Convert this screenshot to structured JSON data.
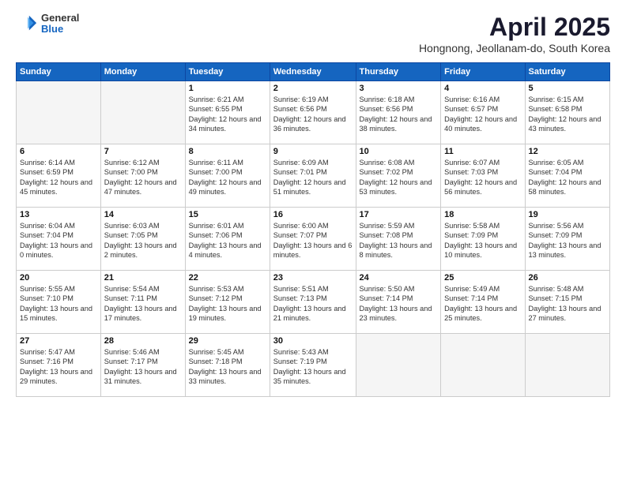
{
  "header": {
    "logo_general": "General",
    "logo_blue": "Blue",
    "main_title": "April 2025",
    "subtitle": "Hongnong, Jeollanam-do, South Korea"
  },
  "days_of_week": [
    "Sunday",
    "Monday",
    "Tuesday",
    "Wednesday",
    "Thursday",
    "Friday",
    "Saturday"
  ],
  "weeks": [
    [
      {
        "day": "",
        "info": ""
      },
      {
        "day": "",
        "info": ""
      },
      {
        "day": "1",
        "info": "Sunrise: 6:21 AM\nSunset: 6:55 PM\nDaylight: 12 hours and 34 minutes."
      },
      {
        "day": "2",
        "info": "Sunrise: 6:19 AM\nSunset: 6:56 PM\nDaylight: 12 hours and 36 minutes."
      },
      {
        "day": "3",
        "info": "Sunrise: 6:18 AM\nSunset: 6:56 PM\nDaylight: 12 hours and 38 minutes."
      },
      {
        "day": "4",
        "info": "Sunrise: 6:16 AM\nSunset: 6:57 PM\nDaylight: 12 hours and 40 minutes."
      },
      {
        "day": "5",
        "info": "Sunrise: 6:15 AM\nSunset: 6:58 PM\nDaylight: 12 hours and 43 minutes."
      }
    ],
    [
      {
        "day": "6",
        "info": "Sunrise: 6:14 AM\nSunset: 6:59 PM\nDaylight: 12 hours and 45 minutes."
      },
      {
        "day": "7",
        "info": "Sunrise: 6:12 AM\nSunset: 7:00 PM\nDaylight: 12 hours and 47 minutes."
      },
      {
        "day": "8",
        "info": "Sunrise: 6:11 AM\nSunset: 7:00 PM\nDaylight: 12 hours and 49 minutes."
      },
      {
        "day": "9",
        "info": "Sunrise: 6:09 AM\nSunset: 7:01 PM\nDaylight: 12 hours and 51 minutes."
      },
      {
        "day": "10",
        "info": "Sunrise: 6:08 AM\nSunset: 7:02 PM\nDaylight: 12 hours and 53 minutes."
      },
      {
        "day": "11",
        "info": "Sunrise: 6:07 AM\nSunset: 7:03 PM\nDaylight: 12 hours and 56 minutes."
      },
      {
        "day": "12",
        "info": "Sunrise: 6:05 AM\nSunset: 7:04 PM\nDaylight: 12 hours and 58 minutes."
      }
    ],
    [
      {
        "day": "13",
        "info": "Sunrise: 6:04 AM\nSunset: 7:04 PM\nDaylight: 13 hours and 0 minutes."
      },
      {
        "day": "14",
        "info": "Sunrise: 6:03 AM\nSunset: 7:05 PM\nDaylight: 13 hours and 2 minutes."
      },
      {
        "day": "15",
        "info": "Sunrise: 6:01 AM\nSunset: 7:06 PM\nDaylight: 13 hours and 4 minutes."
      },
      {
        "day": "16",
        "info": "Sunrise: 6:00 AM\nSunset: 7:07 PM\nDaylight: 13 hours and 6 minutes."
      },
      {
        "day": "17",
        "info": "Sunrise: 5:59 AM\nSunset: 7:08 PM\nDaylight: 13 hours and 8 minutes."
      },
      {
        "day": "18",
        "info": "Sunrise: 5:58 AM\nSunset: 7:09 PM\nDaylight: 13 hours and 10 minutes."
      },
      {
        "day": "19",
        "info": "Sunrise: 5:56 AM\nSunset: 7:09 PM\nDaylight: 13 hours and 13 minutes."
      }
    ],
    [
      {
        "day": "20",
        "info": "Sunrise: 5:55 AM\nSunset: 7:10 PM\nDaylight: 13 hours and 15 minutes."
      },
      {
        "day": "21",
        "info": "Sunrise: 5:54 AM\nSunset: 7:11 PM\nDaylight: 13 hours and 17 minutes."
      },
      {
        "day": "22",
        "info": "Sunrise: 5:53 AM\nSunset: 7:12 PM\nDaylight: 13 hours and 19 minutes."
      },
      {
        "day": "23",
        "info": "Sunrise: 5:51 AM\nSunset: 7:13 PM\nDaylight: 13 hours and 21 minutes."
      },
      {
        "day": "24",
        "info": "Sunrise: 5:50 AM\nSunset: 7:14 PM\nDaylight: 13 hours and 23 minutes."
      },
      {
        "day": "25",
        "info": "Sunrise: 5:49 AM\nSunset: 7:14 PM\nDaylight: 13 hours and 25 minutes."
      },
      {
        "day": "26",
        "info": "Sunrise: 5:48 AM\nSunset: 7:15 PM\nDaylight: 13 hours and 27 minutes."
      }
    ],
    [
      {
        "day": "27",
        "info": "Sunrise: 5:47 AM\nSunset: 7:16 PM\nDaylight: 13 hours and 29 minutes."
      },
      {
        "day": "28",
        "info": "Sunrise: 5:46 AM\nSunset: 7:17 PM\nDaylight: 13 hours and 31 minutes."
      },
      {
        "day": "29",
        "info": "Sunrise: 5:45 AM\nSunset: 7:18 PM\nDaylight: 13 hours and 33 minutes."
      },
      {
        "day": "30",
        "info": "Sunrise: 5:43 AM\nSunset: 7:19 PM\nDaylight: 13 hours and 35 minutes."
      },
      {
        "day": "",
        "info": ""
      },
      {
        "day": "",
        "info": ""
      },
      {
        "day": "",
        "info": ""
      }
    ]
  ]
}
